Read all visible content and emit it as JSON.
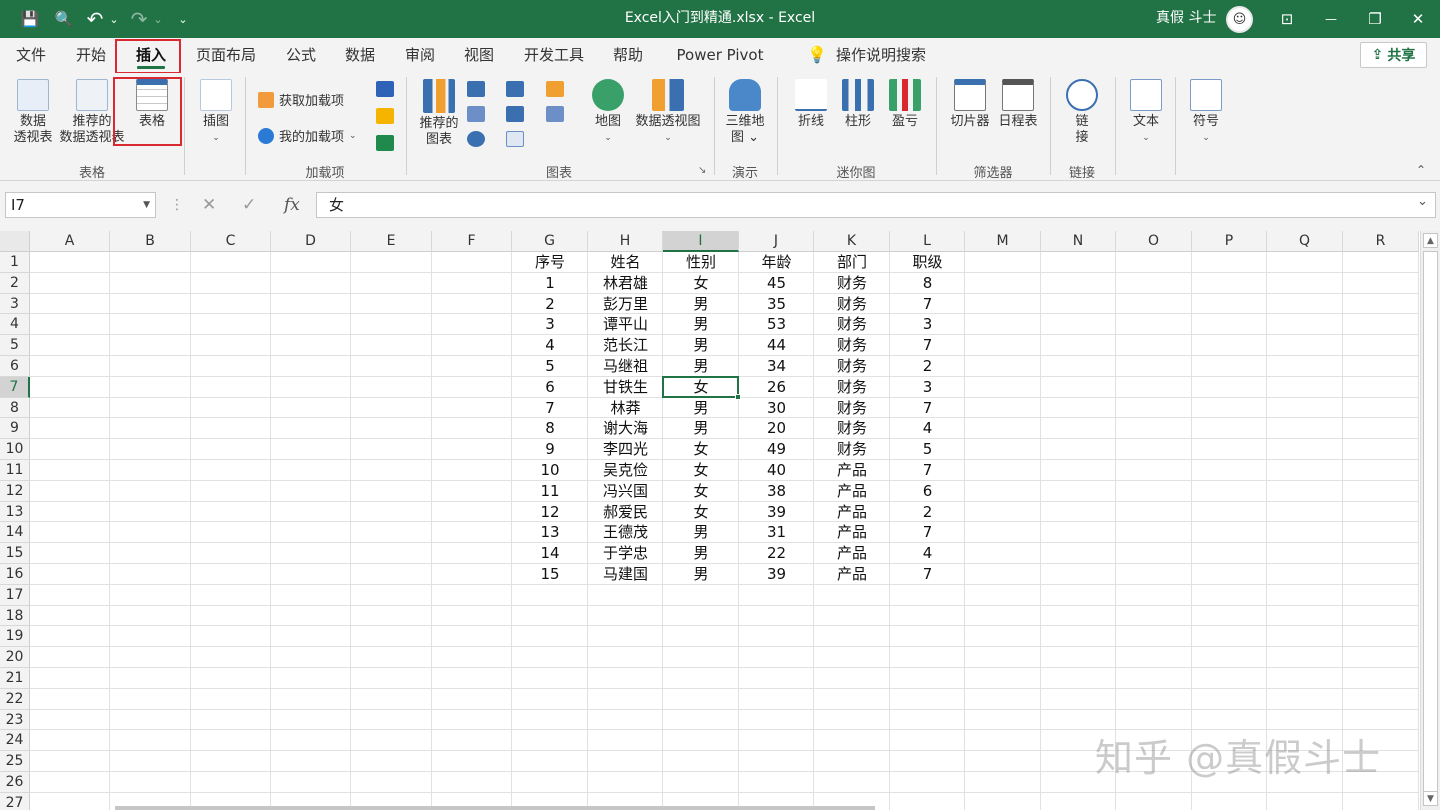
{
  "window": {
    "title": "Excel入门到精通.xlsx  -  Excel",
    "user_name": "真假 斗士",
    "avatar_glyph": "☺"
  },
  "quick_access": {
    "save_glyph": "💾",
    "preview_glyph": "🔍",
    "undo_glyph": "↶",
    "undo_caret": "⌄",
    "redo_glyph": "↷",
    "redo_caret": "⌄",
    "customize_glyph": "⌄"
  },
  "window_controls": {
    "ribbon_display_glyph": "⊡",
    "minimize_glyph": "—",
    "restore_glyph": "❐",
    "close_glyph": "✕"
  },
  "tabs": [
    {
      "label": "文件"
    },
    {
      "label": "开始"
    },
    {
      "label": "插入"
    },
    {
      "label": "页面布局"
    },
    {
      "label": "公式"
    },
    {
      "label": "数据"
    },
    {
      "label": "审阅"
    },
    {
      "label": "视图"
    },
    {
      "label": "开发工具"
    },
    {
      "label": "帮助"
    },
    {
      "label": "Power Pivot"
    }
  ],
  "active_tab": "插入",
  "tell_me": {
    "icon": "lightbulb-icon",
    "glyph": "💡",
    "label": "操作说明搜索"
  },
  "share": {
    "icon": "share-icon",
    "glyph": "⇪",
    "label": "共享"
  },
  "ribbon": {
    "groups": {
      "tables": "表格",
      "addins": "加载项",
      "charts": "图表",
      "tours": "演示",
      "sparklines": "迷你图",
      "filters": "筛选器",
      "links": "链接"
    },
    "pivot_table": {
      "line1": "数据",
      "line2": "透视表"
    },
    "recommended_pivot": {
      "line1": "推荐的",
      "line2": "数据透视表"
    },
    "table": {
      "label": "表格"
    },
    "illustrations": {
      "label": "插图",
      "caret": "⌄"
    },
    "get_addins": {
      "label": "获取加载项"
    },
    "my_addins": {
      "label": "我的加载项",
      "caret": "⌄"
    },
    "recommended_charts": {
      "line1": "推荐的",
      "line2": "图表"
    },
    "maps": {
      "label": "地图",
      "caret": "⌄"
    },
    "pivot_chart": {
      "label": "数据透视图",
      "caret": "⌄"
    },
    "charts_launcher_glyph": "↘",
    "chart_caret": "⌄",
    "map3d": {
      "line1": "三维地",
      "line2": "图 ⌄"
    },
    "spark_line": {
      "label": "折线"
    },
    "spark_column": {
      "label": "柱形"
    },
    "spark_winloss": {
      "label": "盈亏"
    },
    "slicer": {
      "label": "切片器"
    },
    "timeline": {
      "label": "日程表"
    },
    "link": {
      "line1": "链",
      "line2": "接"
    },
    "text": {
      "label": "文本",
      "caret": "⌄"
    },
    "symbol": {
      "label": "符号",
      "caret": "⌄"
    },
    "collapse_glyph": "⌃"
  },
  "formula_bar": {
    "name_box": "I7",
    "name_caret": "▼",
    "dots_glyph": "⋮",
    "cancel_glyph": "✕",
    "enter_glyph": "✓",
    "fx_label": "fx",
    "content": "女",
    "expand_glyph": "⌄"
  },
  "sheet": {
    "columns": [
      "A",
      "B",
      "C",
      "D",
      "E",
      "F",
      "G",
      "H",
      "I",
      "J",
      "K",
      "L",
      "M",
      "N",
      "O",
      "P",
      "Q",
      "R"
    ],
    "row_numbers": [
      "1",
      "2",
      "3",
      "4",
      "5",
      "6",
      "7",
      "8",
      "9",
      "10",
      "11",
      "12",
      "13",
      "14",
      "15",
      "16",
      "17",
      "18",
      "19",
      "20",
      "21",
      "22",
      "23",
      "24",
      "25",
      "26",
      "27"
    ],
    "selected_column": "I",
    "selected_row": "7",
    "selected_cell": "I7",
    "table": {
      "headers": [
        "序号",
        "姓名",
        "性别",
        "年龄",
        "部门",
        "职级"
      ],
      "rows": [
        [
          "1",
          "林君雄",
          "女",
          "45",
          "财务",
          "8"
        ],
        [
          "2",
          "彭万里",
          "男",
          "35",
          "财务",
          "7"
        ],
        [
          "3",
          "谭平山",
          "男",
          "53",
          "财务",
          "3"
        ],
        [
          "4",
          "范长江",
          "男",
          "44",
          "财务",
          "7"
        ],
        [
          "5",
          "马继祖",
          "男",
          "34",
          "财务",
          "2"
        ],
        [
          "6",
          "甘铁生",
          "女",
          "26",
          "财务",
          "3"
        ],
        [
          "7",
          "林莽",
          "男",
          "30",
          "财务",
          "7"
        ],
        [
          "8",
          "谢大海",
          "男",
          "20",
          "财务",
          "4"
        ],
        [
          "9",
          "李四光",
          "女",
          "49",
          "财务",
          "5"
        ],
        [
          "10",
          "吴克俭",
          "女",
          "40",
          "产品",
          "7"
        ],
        [
          "11",
          "冯兴国",
          "女",
          "38",
          "产品",
          "6"
        ],
        [
          "12",
          "郝爱民",
          "女",
          "39",
          "产品",
          "2"
        ],
        [
          "13",
          "王德茂",
          "男",
          "31",
          "产品",
          "7"
        ],
        [
          "14",
          "于学忠",
          "男",
          "22",
          "产品",
          "4"
        ],
        [
          "15",
          "马建国",
          "男",
          "39",
          "产品",
          "7"
        ]
      ]
    }
  },
  "scrollbar": {
    "up_glyph": "▲",
    "down_glyph": "▼"
  },
  "watermark": "知乎 @真假斗士",
  "colors": {
    "excel_green": "#217346",
    "highlight_red": "#d9282f"
  }
}
